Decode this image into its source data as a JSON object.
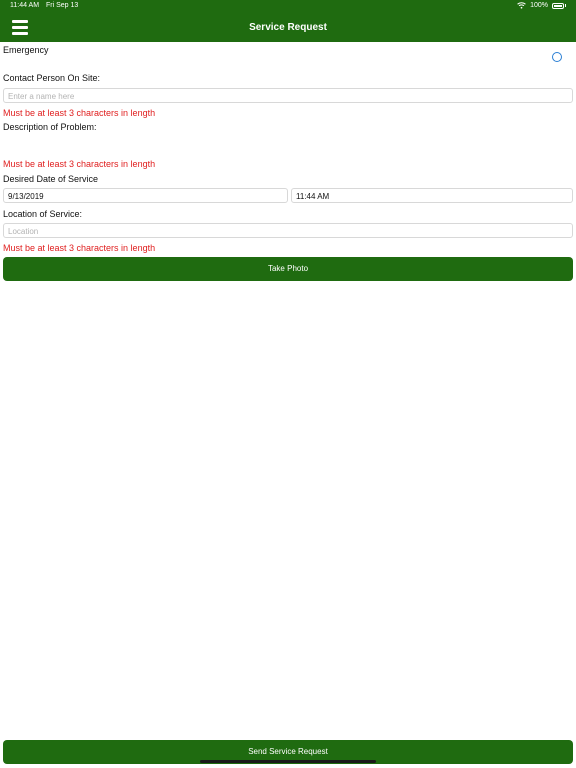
{
  "status_bar": {
    "time": "11:44 AM",
    "date": "Fri Sep 13",
    "battery": "100%"
  },
  "header": {
    "title": "Service Request"
  },
  "form": {
    "emergency_label": "Emergency",
    "contact_label": "Contact Person On Site:",
    "contact_placeholder": "Enter a name here",
    "contact_error": "Must be at least 3 characters in length",
    "description_label": "Description of Problem:",
    "description_error": "Must be at least 3 characters in length",
    "date_label": "Desired Date of Service",
    "date_value": "9/13/2019",
    "time_value": "11:44 AM",
    "location_label": "Location of Service:",
    "location_placeholder": "Location",
    "location_error": "Must be at least 3 characters in length"
  },
  "buttons": {
    "take_photo": "Take Photo",
    "send": "Send Service Request"
  },
  "colors": {
    "header": "#1f6b10",
    "error": "#e02020",
    "radio": "#2a7fd4"
  }
}
